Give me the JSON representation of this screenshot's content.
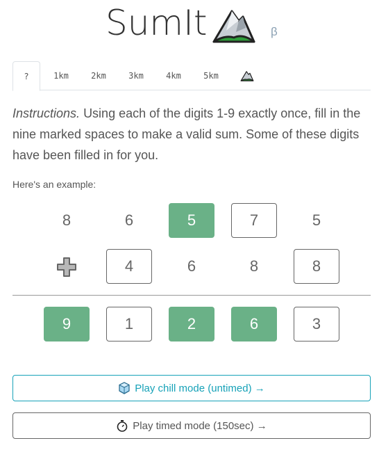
{
  "app": {
    "title": "SumIt",
    "beta": "β",
    "logo_icon": "mountain-icon"
  },
  "tabs": [
    {
      "label": "?",
      "active": true
    },
    {
      "label": "1km"
    },
    {
      "label": "2km"
    },
    {
      "label": "3km"
    },
    {
      "label": "4km"
    },
    {
      "label": "5km"
    },
    {
      "label": "",
      "icon": "mountain-icon"
    }
  ],
  "instructions": {
    "lead": "Instructions.",
    "body": "Using each of the digits 1-9 exactly once, fill in the nine marked spaces to make a valid sum. Some of these digits have been filled in for you."
  },
  "example": {
    "label": "Here's an example:",
    "row1": [
      "8",
      "6",
      "5",
      "7",
      "5"
    ],
    "row2": [
      "4",
      "6",
      "8",
      "8"
    ],
    "result": [
      "9",
      "1",
      "2",
      "6",
      "3"
    ],
    "plus_icon": "plus-icon",
    "colors": {
      "filled": "#6ab187"
    }
  },
  "buttons": {
    "chill": {
      "label": "Play chill mode (untimed) →",
      "icon": "ice-cube-icon",
      "color": "#17a2b8"
    },
    "timed": {
      "label": "Play timed mode (150sec) →",
      "icon": "stopwatch-icon"
    }
  }
}
